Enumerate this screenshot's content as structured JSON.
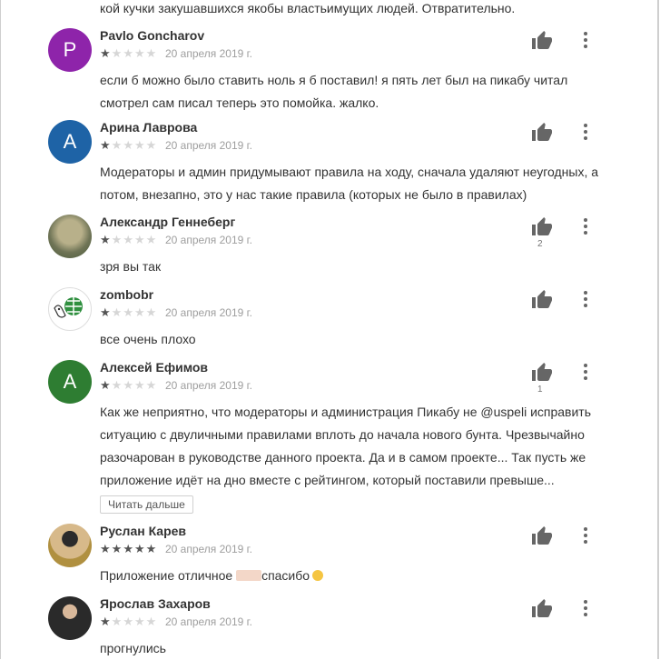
{
  "top_fragment": "кой кучки закушавшихся якобы властьимущих людей. Отвратительно.",
  "reviews": [
    {
      "author": "Pavlo Goncharov",
      "avatar_letter": "P",
      "avatar_color": "#8e24aa",
      "rating": 1,
      "date": "20 апреля 2019 г.",
      "text": "если б можно было ставить ноль я б поставил! я пять лет был на пикабу читал смотрел сам писал теперь это помойка. жалко.",
      "likes": ""
    },
    {
      "author": "Арина Лаврова",
      "avatar_letter": "А",
      "avatar_color": "#1e63a6",
      "rating": 1,
      "date": "20 апреля 2019 г.",
      "text": "Модераторы и админ придумывают правила на ходу, сначала удаляют неугодных, а потом, внезапно, это у нас такие правила (которых не было в правилах)",
      "likes": ""
    },
    {
      "author": "Александр Геннеберг",
      "avatar_letter": "",
      "avatar_color": "#8a8a6a",
      "rating": 1,
      "date": "20 апреля 2019 г.",
      "text": "зря вы так",
      "likes": "2"
    },
    {
      "author": "zombobr",
      "avatar_letter": "",
      "avatar_color": "#ffffff",
      "rating": 1,
      "date": "20 апреля 2019 г.",
      "text": "все очень плохо",
      "likes": ""
    },
    {
      "author": "Алексей Ефимов",
      "avatar_letter": "А",
      "avatar_color": "#2e7d32",
      "rating": 1,
      "date": "20 апреля 2019 г.",
      "text": "Как же неприятно, что модераторы и администрация Пикабу не @uspeli исправить ситуацию с двуличными правилами вплоть до начала нового бунта. Чрезвычайно разочарован в руководстве данного проекта. Да и в самом проекте... Так пусть же приложение идёт на дно вместе с рейтингом, который поставили превыше...",
      "likes": "1",
      "read_more": "Читать дальше"
    },
    {
      "author": "Руслан Карев",
      "avatar_letter": "",
      "avatar_color": "#c9b26a",
      "rating": 5,
      "date": "20 апреля 2019 г.",
      "text_before": "Приложение отличное ",
      "text_after": "спасибо",
      "likes": ""
    },
    {
      "author": "Ярослав Захаров",
      "avatar_letter": "",
      "avatar_color": "#3a3a3a",
      "rating": 1,
      "date": "20 апреля 2019 г.",
      "text": "прогнулись",
      "likes": ""
    }
  ],
  "icons": {
    "like": "thumbs-up-icon",
    "more": "more-vert-icon",
    "star": "star-icon"
  },
  "colors": {
    "star_on": "#555555",
    "star_off": "#d6d6d6",
    "icon": "#666666",
    "date": "#9e9e9e"
  }
}
